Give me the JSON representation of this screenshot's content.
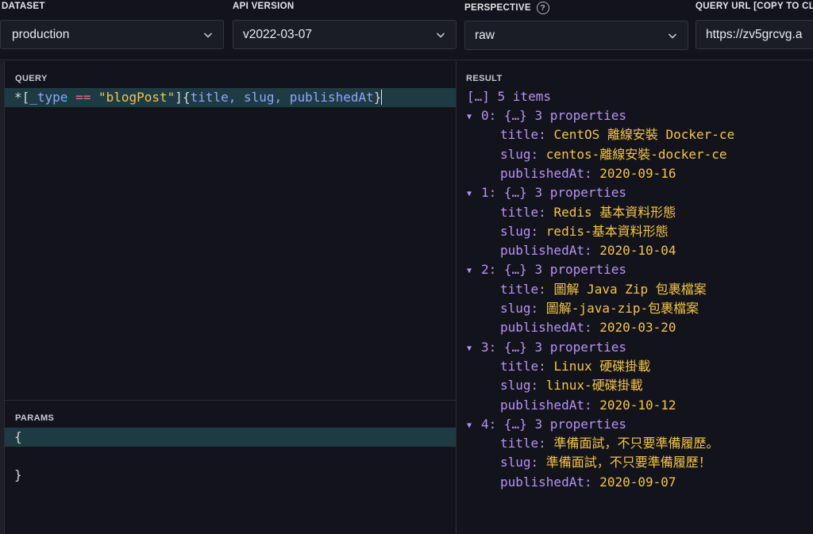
{
  "toolbar": {
    "dataset": {
      "label": "DATASET",
      "value": "production"
    },
    "api_version": {
      "label": "API VERSION",
      "value": "v2022-03-07"
    },
    "perspective": {
      "label": "PERSPECTIVE",
      "value": "raw",
      "help_icon": "?"
    },
    "query_url": {
      "label": "QUERY URL [COPY TO CL",
      "value": "https://zv5grcvg.a"
    }
  },
  "query": {
    "label": "QUERY",
    "tokens": {
      "star": "*[",
      "type_field": "_type",
      "eq": " == ",
      "type_value": "\"blogPost\"",
      "close_filter": "]",
      "projection_open": "{",
      "projection_fields": "title, slug, publishedAt",
      "projection_close": "}"
    }
  },
  "params": {
    "label": "PARAMS",
    "lines": [
      "{",
      "",
      "}"
    ]
  },
  "result": {
    "label": "RESULT",
    "summary": "[…] 5 items",
    "item_summary": "{…} 3 properties",
    "items": [
      {
        "index": "0:",
        "title": "CentOS 離線安裝 Docker-ce",
        "slug": "centos-離線安裝-docker-ce",
        "publishedAt": "2020-09-16"
      },
      {
        "index": "1:",
        "title": "Redis 基本資料形態",
        "slug": "redis-基本資料形態",
        "publishedAt": "2020-10-04"
      },
      {
        "index": "2:",
        "title": "圖解 Java Zip 包裹檔案",
        "slug": "圖解-java-zip-包裹檔案",
        "publishedAt": "2020-03-20"
      },
      {
        "index": "3:",
        "title": "Linux 硬碟掛載",
        "slug": "linux-硬碟掛載",
        "publishedAt": "2020-10-12"
      },
      {
        "index": "4:",
        "title": "準備面試，不只要準備履歷。",
        "slug": "準備面試，不只要準備履歷！",
        "publishedAt": "2020-09-07"
      }
    ],
    "keys": {
      "title": "title: ",
      "slug": "slug: ",
      "publishedAt": "publishedAt: "
    },
    "expand_icon": "▼"
  }
}
